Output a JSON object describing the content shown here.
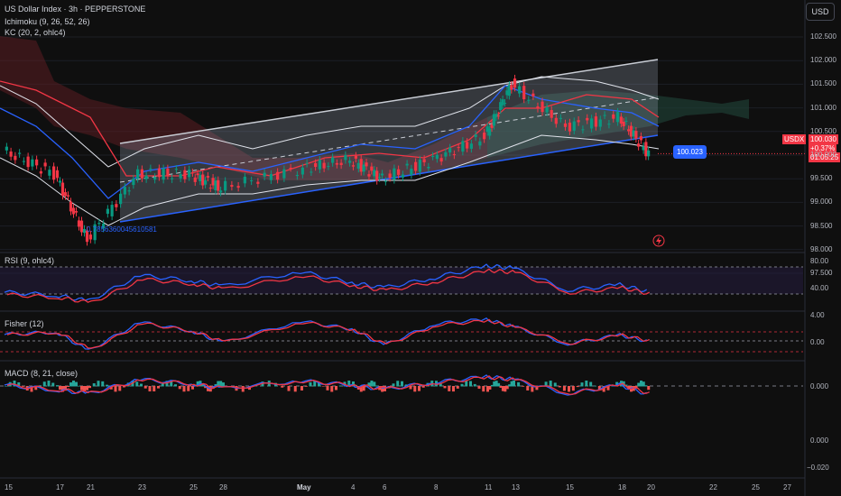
{
  "header": {
    "symbol_line": "US Dollar Index · 3h · PEPPERSTONE",
    "ichimoku": "Ichimoku (9, 26, 52, 26)",
    "kc": "KC (20, 2, ohlc4)",
    "currency": "USD"
  },
  "price_axis": [
    "102.500",
    "102.000",
    "101.500",
    "101.000",
    "100.500",
    "100.000",
    "99.500",
    "99.000",
    "98.500",
    "98.000",
    "97.500"
  ],
  "price_tag": {
    "symbol": "USDX",
    "price": "100.030",
    "change": "+0.37%",
    "countdown": "01:05:25"
  },
  "fib_label": "0.7856360045610581",
  "channel_label": "100.023",
  "rsi": {
    "title": "RSI (9, ohlc4)",
    "axis": [
      "80.00",
      "40.00"
    ],
    "value_tags": [
      "42.59",
      "42.29"
    ]
  },
  "fisher": {
    "title": "Fisher (12)",
    "axis": [
      "4.00",
      "0.00"
    ],
    "value_tags": [
      "-0.82",
      "-0.78"
    ]
  },
  "macd": {
    "title": "MACD (8, 21, close)",
    "axis": [
      "0.000",
      "0.000",
      "−0.020"
    ],
    "value_tags": [
      "-0.055",
      "-0.051"
    ]
  },
  "x_axis": [
    "15",
    "17",
    "21",
    "23",
    "25",
    "28",
    "May",
    "4",
    "6",
    "8",
    "11",
    "13",
    "15",
    "18",
    "20",
    "22",
    "25",
    "27"
  ],
  "colors": {
    "bg": "#0f0f0f",
    "up": "#089981",
    "down": "#f23645",
    "blue": "#2962ff",
    "red": "#f23645",
    "kumo_bear": "#5b1d22",
    "kumo_bull": "#1e3d33",
    "channel": "#b2b5be"
  },
  "chart_data": {
    "type": "line",
    "title": "US Dollar Index · 3h · PEPPERSTONE",
    "x": [
      "15",
      "17",
      "21",
      "23",
      "25",
      "28",
      "May",
      "4",
      "6",
      "8",
      "11",
      "13",
      "15",
      "18",
      "20"
    ],
    "series": [
      {
        "name": "USDX",
        "values": [
          100.1,
          99.6,
          98.2,
          99.6,
          99.6,
          99.3,
          99.7,
          99.9,
          99.5,
          99.9,
          100.4,
          101.5,
          100.6,
          100.8,
          100.03
        ]
      }
    ],
    "ylim": [
      97.5,
      102.5
    ],
    "channel": {
      "upper": [
        [
          98.2,
          99.6
        ],
        [
          102.0,
          101.9
        ]
      ],
      "lower": [
        [
          98.2,
          98.1
        ],
        [
          100.03,
          100.1
        ]
      ]
    },
    "rsi": {
      "ylim": [
        20,
        90
      ],
      "values": [
        42,
        38,
        30,
        65,
        58,
        50,
        70,
        55,
        48,
        62,
        78,
        75,
        45,
        52,
        42.59
      ]
    },
    "fisher": {
      "ylim": [
        -4,
        4
      ],
      "values": [
        0.5,
        1.0,
        -2.5,
        2.8,
        1.2,
        -1.0,
        3.0,
        1.5,
        -1.5,
        2.5,
        3.3,
        2.0,
        -1.2,
        0.4,
        -0.82
      ]
    },
    "macd": {
      "ylim": [
        -0.04,
        0.03
      ],
      "values": [
        0.002,
        -0.005,
        -0.01,
        0.01,
        0.004,
        -0.003,
        0.008,
        0.002,
        -0.004,
        0.006,
        0.014,
        0.01,
        -0.01,
        0.002,
        -0.055
      ]
    }
  }
}
